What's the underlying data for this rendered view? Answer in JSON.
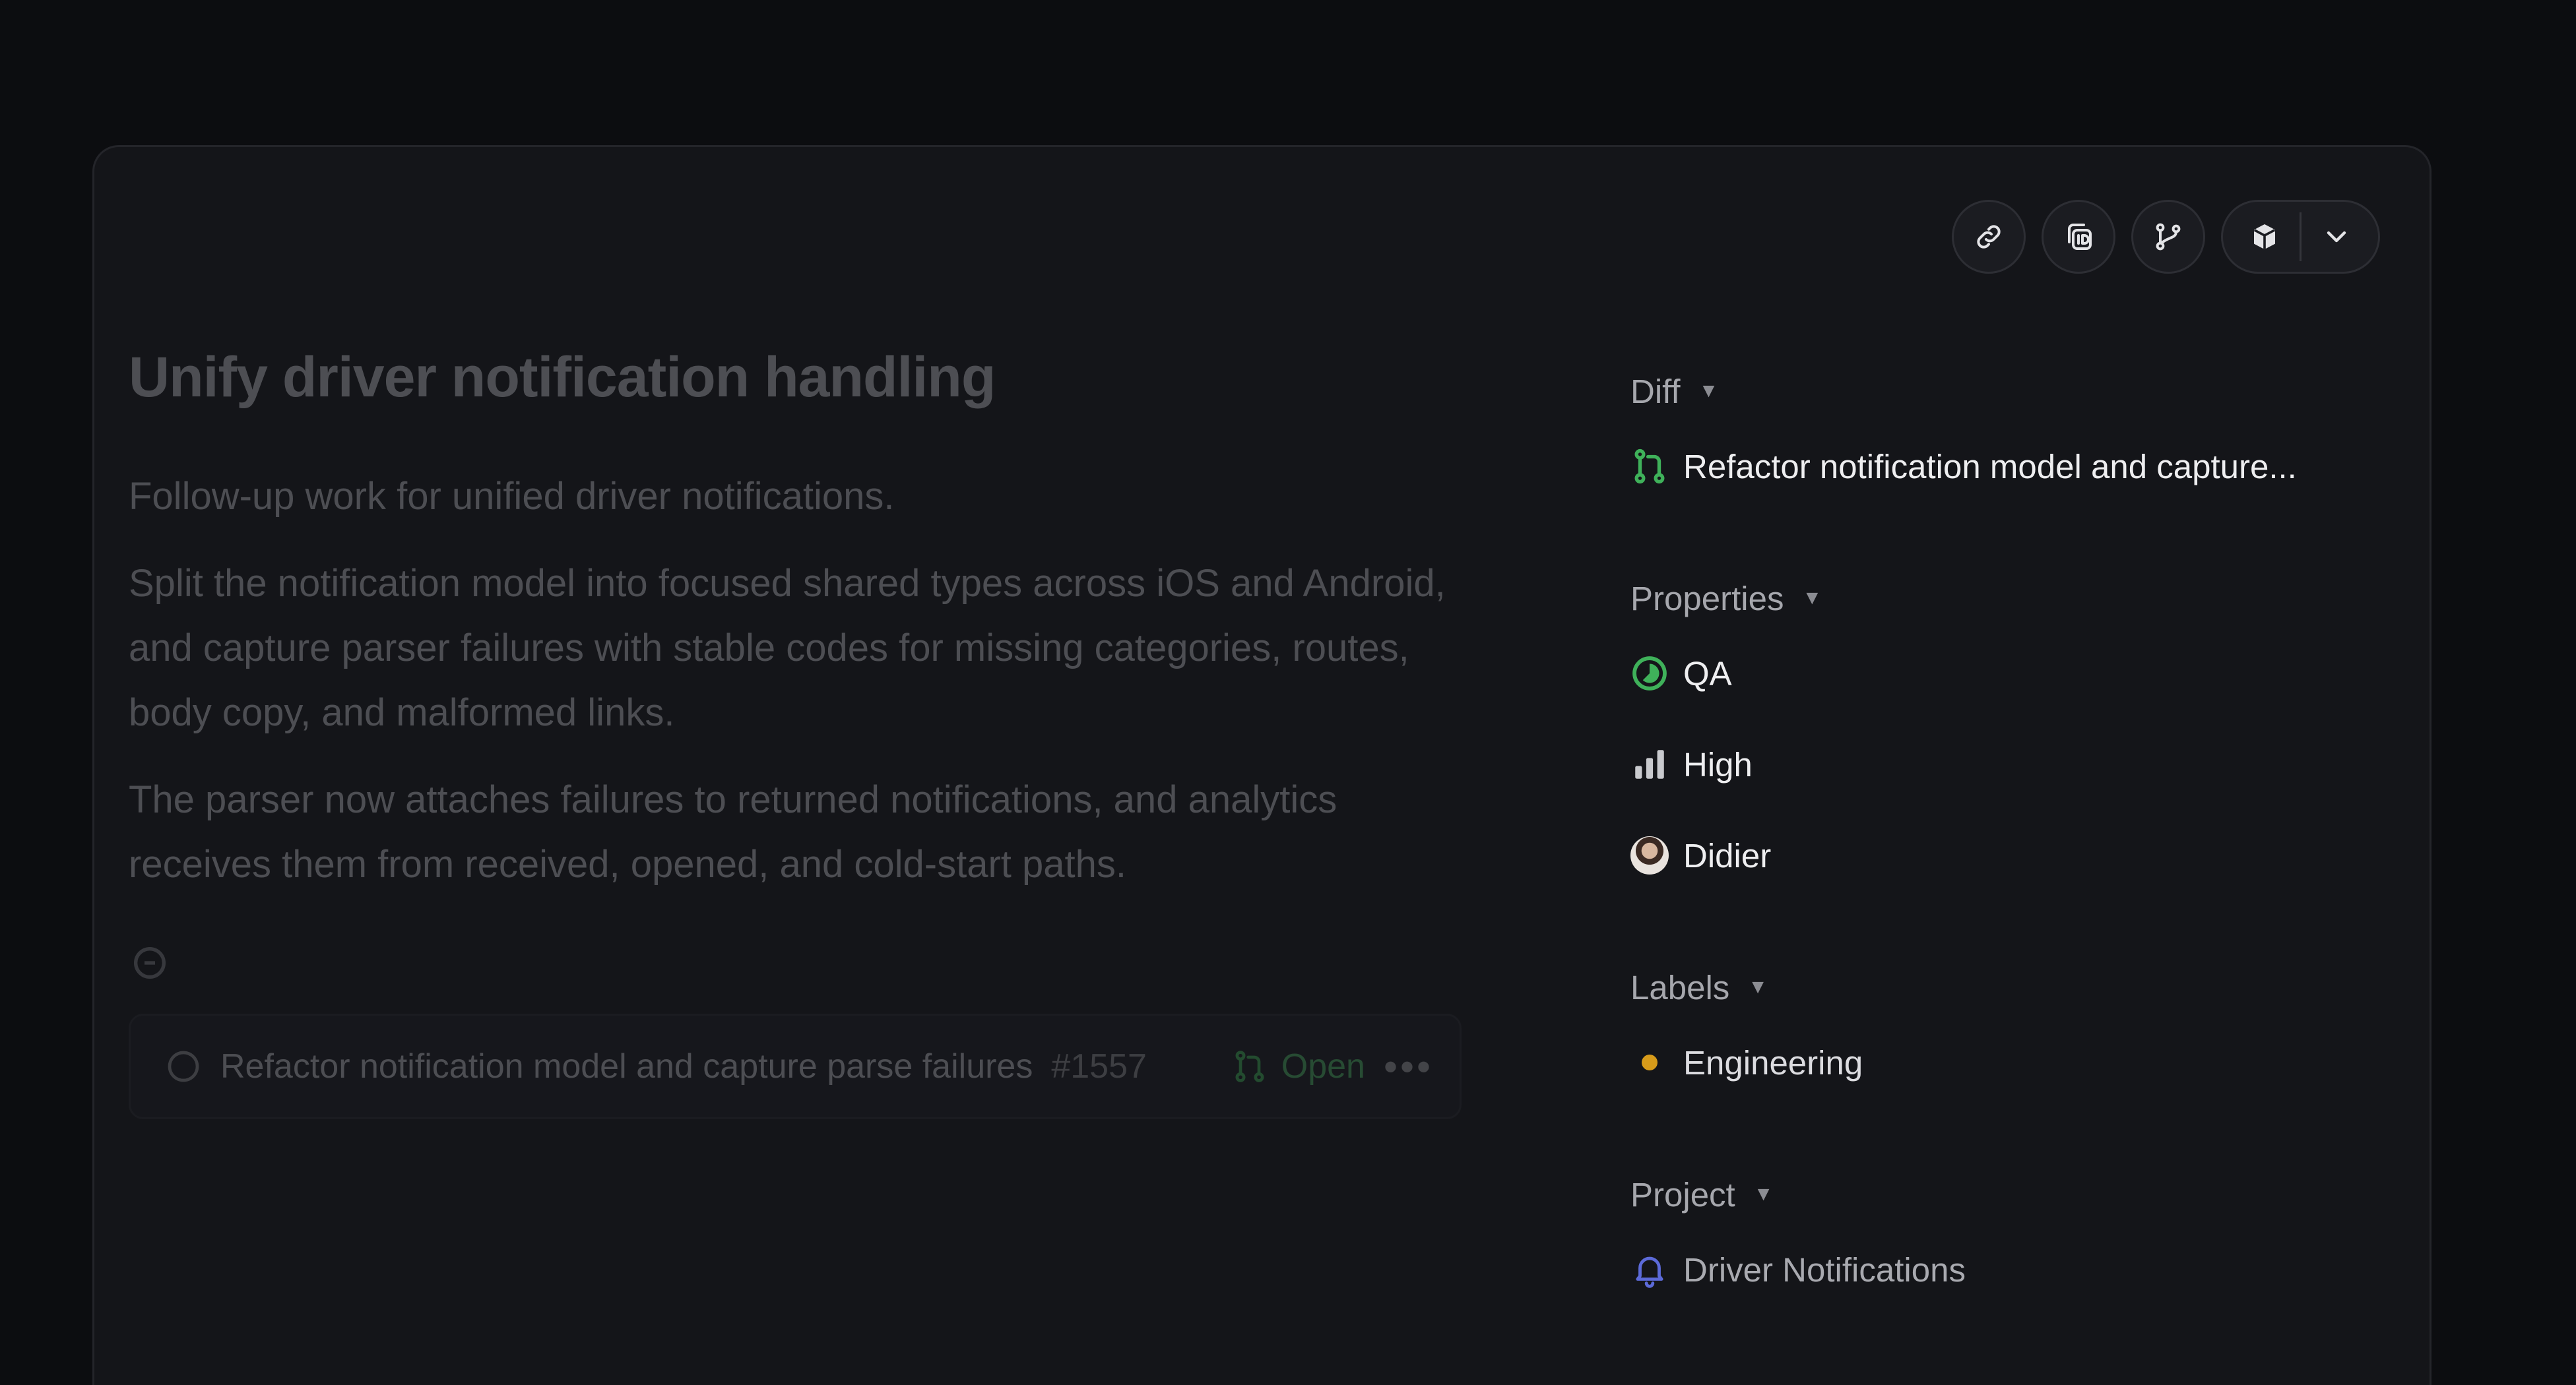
{
  "issue": {
    "title": "Unify driver notification handling",
    "paragraphs": [
      "Follow-up work for unified driver notifications.",
      "Split the notification model into focused shared types across iOS and Android, and capture parser failures with stable codes for missing categories, routes, body copy, and malformed links.",
      "The parser now attaches failures to returned notifications, and analytics receives them from received, opened, and cold-start paths."
    ],
    "pull_request": {
      "title": "Refactor notification model and capture parse failures",
      "number": "#1557",
      "status": "Open",
      "more": "•••"
    }
  },
  "toolbar": {
    "buttons": [
      "link-icon",
      "copy-id-icon",
      "git-branch-icon",
      "package-icon",
      "chevron-down-icon"
    ]
  },
  "sidebar": {
    "diff": {
      "header": "Diff",
      "caret": "▼",
      "item": "Refactor notification model and capture..."
    },
    "properties": {
      "header": "Properties",
      "caret": "▼",
      "status": "QA",
      "priority": "High",
      "assignee": "Didier"
    },
    "labels": {
      "header": "Labels",
      "caret": "▼",
      "items": [
        {
          "name": "Engineering",
          "color": "#d79b1a"
        }
      ]
    },
    "project": {
      "header": "Project",
      "caret": "▼",
      "name": "Driver Notifications"
    }
  },
  "colors": {
    "accent_green": "#3fb15a",
    "project_blue": "#5c6ad8"
  }
}
